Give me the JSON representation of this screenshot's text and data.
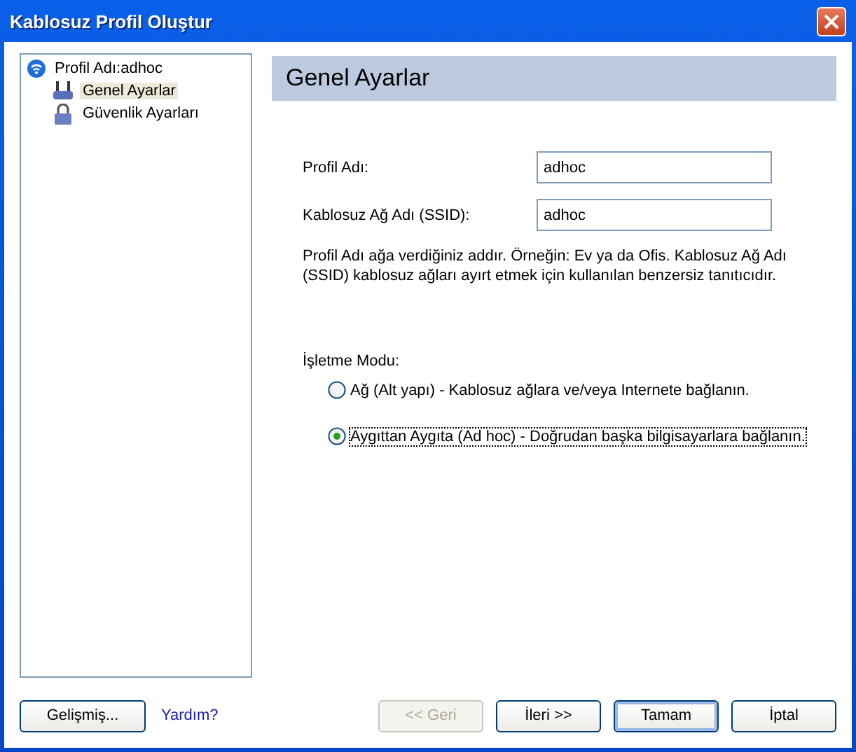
{
  "window": {
    "title": "Kablosuz Profil Oluştur"
  },
  "tree": [
    {
      "label": "Profil Adı:adhoc",
      "kind": "wifi",
      "selected": false,
      "children": [
        {
          "label": "Genel Ayarlar",
          "kind": "router",
          "selected": true
        },
        {
          "label": "Güvenlik Ayarları",
          "kind": "lock",
          "selected": false
        }
      ]
    }
  ],
  "panel": {
    "title": "Genel Ayarlar",
    "fields": [
      {
        "label": "Profil Adı:",
        "value": "adhoc"
      },
      {
        "label": "Kablosuz Ağ Adı  (SSID):",
        "value": "adhoc"
      }
    ],
    "description": "Profil Adı ağa verdiğiniz addır. Örneğin: Ev ya da Ofis. Kablosuz Ağ Adı (SSID) kablosuz ağları ayırt etmek için kullanılan benzersiz tanıtıcıdır.",
    "mode_label": "İşletme Modu:",
    "modes": [
      {
        "label": "Ağ (Alt yapı) - Kablosuz ağlara ve/veya Internete bağlanın.",
        "selected": false
      },
      {
        "label": "Aygıttan Aygıta (Ad hoc) - Doğrudan başka bilgisayarlara bağlanın.",
        "selected": true
      }
    ]
  },
  "footer": {
    "advanced": "Gelişmiş...",
    "help": "Yardım?",
    "buttons": [
      {
        "label": "<< Geri",
        "disabled": true,
        "default": false
      },
      {
        "label": "İleri >>",
        "disabled": false,
        "default": false
      },
      {
        "label": "Tamam",
        "disabled": false,
        "default": true
      },
      {
        "label": "İptal",
        "disabled": false,
        "default": false
      }
    ]
  }
}
